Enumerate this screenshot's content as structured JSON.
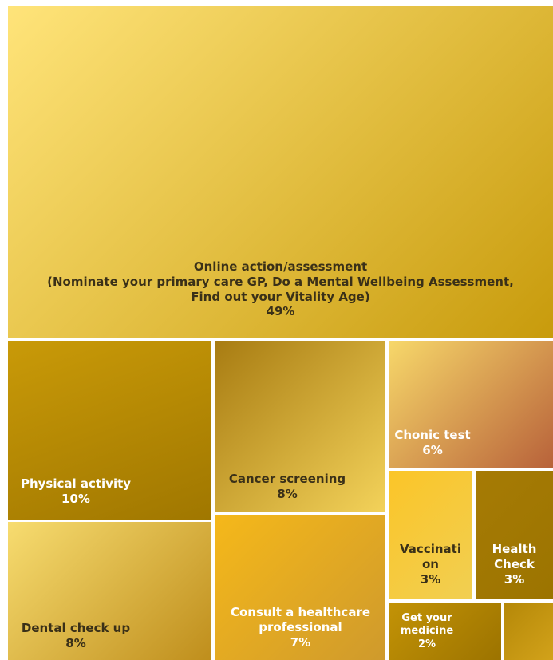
{
  "chart_data": {
    "type": "treemap",
    "title": "",
    "items": [
      {
        "id": "online",
        "label_lines": [
          "Online action/assessment",
          "(Nominate your primary care GP, Do a Mental Wellbeing Assessment,",
          "Find out your Vitality Age)"
        ],
        "value_label": "49%",
        "value": 49,
        "gradient": [
          "#ffe47a",
          "#c89b0c"
        ],
        "text_color": "#3a3018"
      },
      {
        "id": "physical",
        "label_lines": [
          "Physical activity"
        ],
        "value_label": "10%",
        "value": 10,
        "gradient": [
          "#c99a08",
          "#a07700"
        ],
        "text_color": "#ffffff"
      },
      {
        "id": "cancer",
        "label_lines": [
          "Cancer screening"
        ],
        "value_label": "8%",
        "value": 8,
        "gradient": [
          "#a87c12",
          "#f3d25a"
        ],
        "text_color": "#3a3018"
      },
      {
        "id": "chronic",
        "label_lines": [
          "Chonic test"
        ],
        "value_label": "6%",
        "value": 6,
        "gradient": [
          "#f7d86a",
          "#b8623a"
        ],
        "text_color": "#ffffff"
      },
      {
        "id": "dental",
        "label_lines": [
          "Dental check up"
        ],
        "value_label": "8%",
        "value": 8,
        "gradient": [
          "#f7dc70",
          "#bf8e1c"
        ],
        "text_color": "#3a3018"
      },
      {
        "id": "consult",
        "label_lines": [
          "Consult a healthcare",
          "professional"
        ],
        "value_label": "7%",
        "value": 7,
        "gradient": [
          "#f5b81a",
          "#cf9a2c"
        ],
        "text_color": "#ffffff"
      },
      {
        "id": "vaccination",
        "label_lines": [
          "Vaccinati",
          "on"
        ],
        "value_label": "3%",
        "value": 3,
        "gradient": [
          "#fbc528",
          "#f1cf52"
        ],
        "text_color": "#3a3018"
      },
      {
        "id": "health",
        "label_lines": [
          "Health",
          "Check"
        ],
        "value_label": "3%",
        "value": 3,
        "gradient": [
          "#a67b05",
          "#9c7400"
        ],
        "text_color": "#ffffff"
      },
      {
        "id": "medicine",
        "label_lines": [
          "Get your",
          "medicine"
        ],
        "value_label": "2%",
        "value": 2,
        "gradient": [
          "#c39306",
          "#9c7300"
        ],
        "text_color": "#ffffff"
      },
      {
        "id": "other",
        "label_lines": [],
        "value_label": "",
        "value": null,
        "gradient": [
          "#b58808",
          "#d2a21a"
        ],
        "text_color": "#ffffff"
      }
    ]
  }
}
